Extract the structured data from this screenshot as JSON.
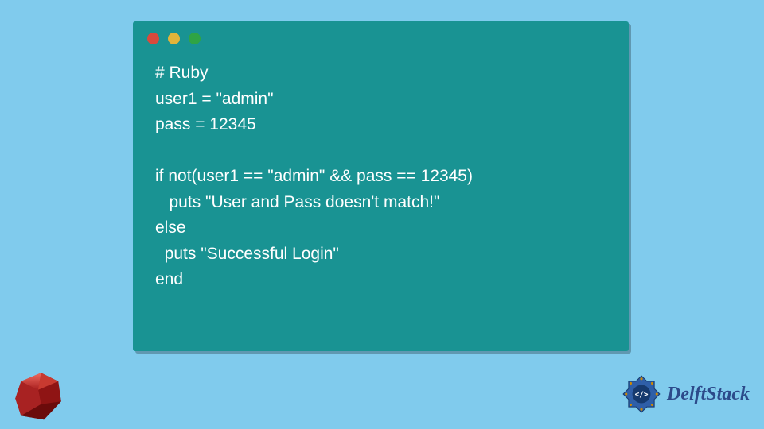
{
  "window": {
    "dot_colors": {
      "red": "#d94a3d",
      "yellow": "#e2b43a",
      "green": "#2fa445"
    }
  },
  "code": {
    "lines": [
      "# Ruby",
      "user1 = \"admin\"",
      "pass = 12345",
      "",
      "if not(user1 == \"admin\" && pass == 12345)",
      "   puts \"User and Pass doesn't match!\"",
      "else",
      "  puts \"Successful Login\"",
      "end"
    ]
  },
  "branding": {
    "site_name": "DelftStack",
    "ruby_icon_label": "Ruby gem",
    "logo_label": "DelftStack logo"
  }
}
